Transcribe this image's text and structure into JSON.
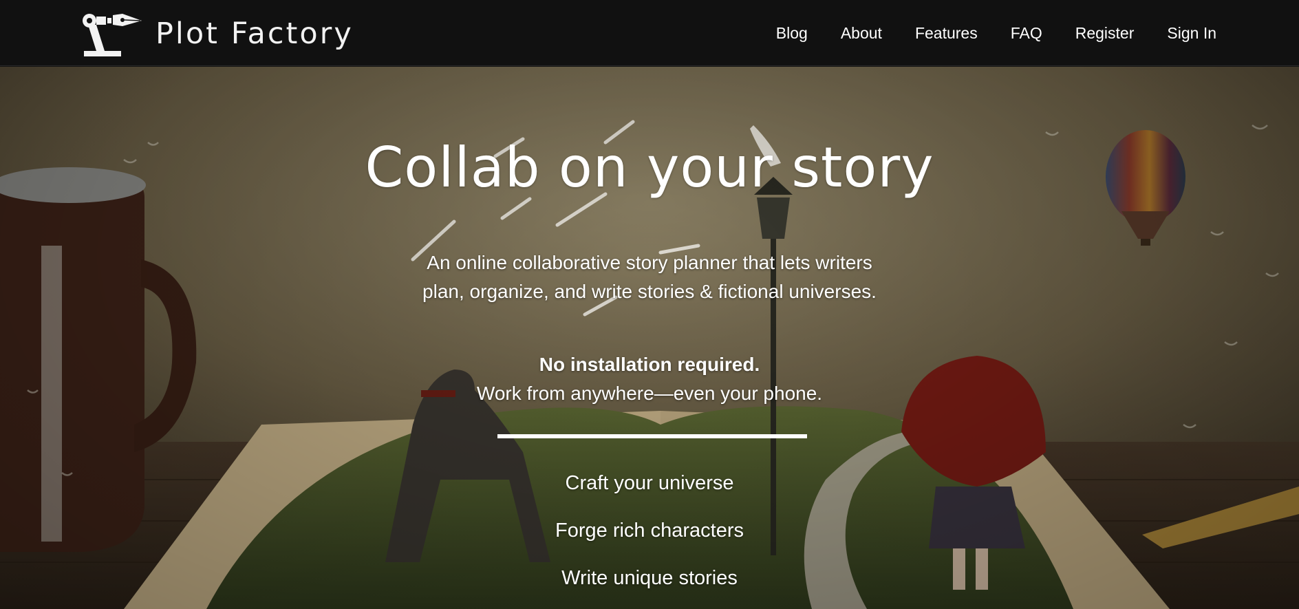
{
  "brand": {
    "name": "Plot Factory",
    "logo_icon": "robot-arm-pen-icon"
  },
  "nav": {
    "links": [
      "Blog",
      "About",
      "Features",
      "FAQ",
      "Register",
      "Sign In"
    ]
  },
  "hero": {
    "title": "Collab on your story",
    "description": "An online collaborative story planner that lets writers plan, organize, and write stories & fictional universes.",
    "strong_line": "No installation required.",
    "sub_line": "Work from anywhere—even your phone.",
    "features": [
      "Craft your universe",
      "Forge rich characters",
      "Write unique stories"
    ]
  },
  "colors": {
    "nav_bg": "#111111",
    "text": "#ffffff"
  }
}
